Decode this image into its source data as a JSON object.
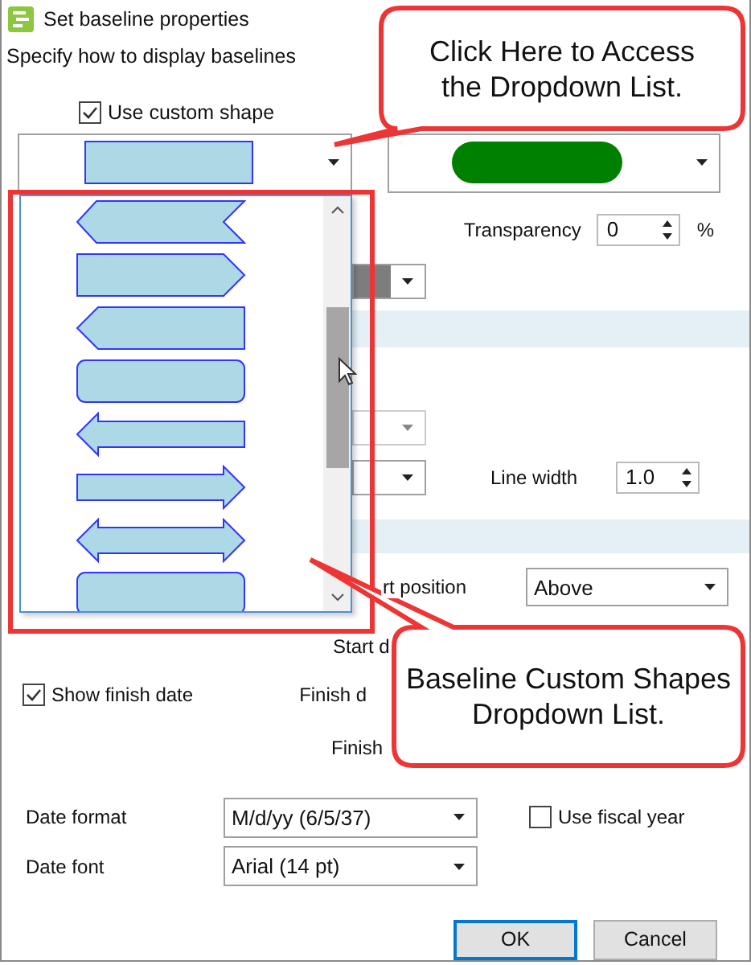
{
  "window": {
    "title": "Set baseline properties"
  },
  "subtitle": "Specify how to display baselines",
  "custom_shape": {
    "label": "Use custom shape",
    "checked": true
  },
  "shape_combo": {
    "kind": "rect"
  },
  "color_combo": {
    "color": "#008000"
  },
  "shape_list": [
    {
      "kind": "flag-left"
    },
    {
      "kind": "pointed-right"
    },
    {
      "kind": "pointed-left"
    },
    {
      "kind": "rounded"
    },
    {
      "kind": "arrow-left"
    },
    {
      "kind": "arrow-right"
    },
    {
      "kind": "arrow-both"
    },
    {
      "kind": "rounded"
    }
  ],
  "transparency": {
    "label": "Transparency",
    "value": "0",
    "unit": "%"
  },
  "line_width": {
    "label": "Line width",
    "value": "1.0"
  },
  "position": {
    "label": "rt position",
    "value": "Above"
  },
  "start_label": "Start d",
  "show_finish_date": {
    "label": "Show finish date",
    "checked": true
  },
  "finish_labels": [
    "Finish d",
    "Finish"
  ],
  "date_format": {
    "label": "Date format",
    "value": "M/d/yy (6/5/37)"
  },
  "fiscal_year": {
    "label": "Use fiscal year",
    "checked": false
  },
  "date_font": {
    "label": "Date font",
    "value": "Arial (14 pt)"
  },
  "buttons": [
    {
      "label": "OK",
      "default": true
    },
    {
      "label": "Cancel",
      "default": false
    }
  ],
  "callouts": [
    {
      "text": "Click Here to Access the Dropdown List."
    },
    {
      "text": "Baseline Custom Shapes Dropdown List."
    }
  ]
}
